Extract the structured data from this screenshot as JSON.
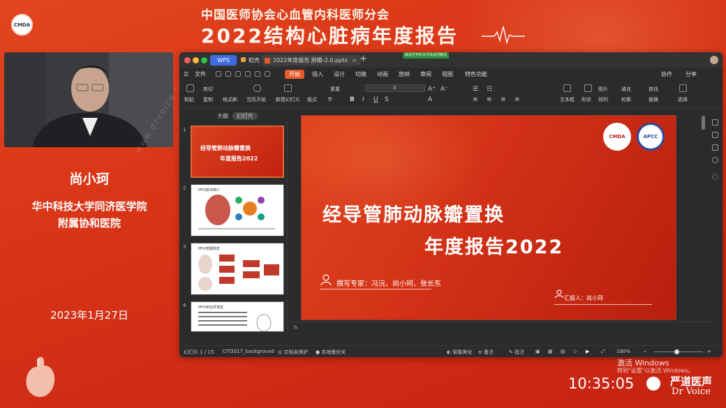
{
  "header": {
    "logo_text": "CMDA",
    "org_title": "中国医师协会心血管内科医师分会",
    "event_title": "2022结构心脏病年度报告"
  },
  "speaker": {
    "name": "尚小珂",
    "affiliation_line1": "华中科技大学同济医学院",
    "affiliation_line2": "附属协和医院",
    "date": "2023年1月27日",
    "watermark": "www.drvoice.cn"
  },
  "window": {
    "tabs": {
      "wps": "WPS",
      "draft": "稻壳",
      "doc": "2022年度报告 肺瓣-2.0.pptx",
      "doc_close": "×",
      "new": "+"
    },
    "top_note": "最近打开的文件及访问路径"
  },
  "menu": {
    "file": "文件",
    "items": [
      "开始",
      "插入",
      "设计",
      "切换",
      "动画",
      "放映",
      "审阅",
      "视图",
      "特色功能"
    ],
    "active": "开始",
    "collaborate": "协作",
    "share": "分享"
  },
  "ribbon": {
    "paste": "粘贴",
    "cut": "剪切",
    "copy": "复制",
    "format_painter": "格式刷",
    "from_current": "当页开始",
    "new_slide": "新建幻灯片",
    "layout": "版式",
    "section": "节",
    "reset": "重置",
    "font_size": "0",
    "textbox": "文本框",
    "shape": "形状",
    "arrange": "排列",
    "image": "图片",
    "fill": "填充",
    "outline": "轮廓",
    "find": "查找",
    "replace": "替换",
    "select": "选择"
  },
  "panel_tabs": {
    "outline": "大纲",
    "slides": "幻灯片"
  },
  "thumbnails": [
    {
      "num": "1",
      "title1": "经导管肺动脉瓣置换",
      "title2": "年度报告2022"
    },
    {
      "num": "2",
      "title1": "PPVI技术简介"
    },
    {
      "num": "3",
      "title1": "PPVI发展简史"
    },
    {
      "num": "4",
      "title1": "PPVI术后并发症"
    }
  ],
  "slide": {
    "title_line1": "经导管肺动脉瓣置换",
    "title_line2": "年度报告2022",
    "authors": "撰写专家：冯沅、尚小珂、张长东",
    "reporter": "汇报人：尚小珂",
    "logo_left": "CMDA",
    "logo_right": "APCC"
  },
  "notes_placeholder": "h",
  "status": {
    "slide_counter": "幻灯片 1 / 15",
    "theme": "CIT2017_background",
    "protect": "文档未保护",
    "backup": "本地备份关",
    "beautify": "智能美化",
    "notes": "备注",
    "comments": "批注",
    "zoom": "100%",
    "minus": "−",
    "plus": "+"
  },
  "bottom": {
    "activate_line1": "激活 Windows",
    "activate_line2": "转到\"设置\"以激活 Windows。",
    "clock": "10:35:05",
    "brand_cn": "严道医声",
    "brand_en": "Dr Voice"
  },
  "colors": {
    "bg_red": "#d93618",
    "accent_orange": "#e85a2a",
    "wps_blue": "#3d6ce0"
  }
}
